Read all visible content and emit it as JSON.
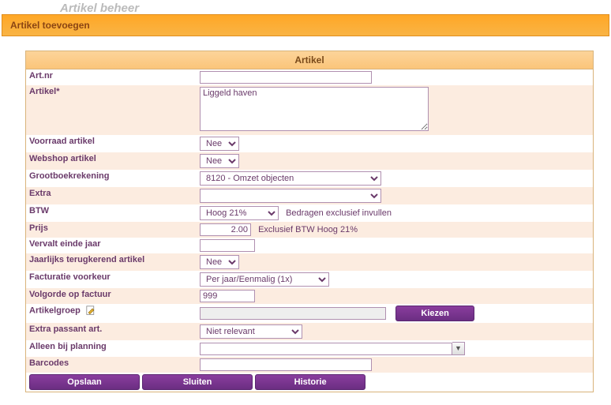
{
  "ghost_header": "Artikel beheer",
  "dialog_title": "Artikel toevoegen",
  "panel_title": "Artikel",
  "labels": {
    "artnr": "Art.nr",
    "artikel": "Artikel*",
    "voorraad": "Voorraad artikel",
    "webshop": "Webshop artikel",
    "grootboek": "Grootboekrekening",
    "extra": "Extra",
    "btw": "BTW",
    "prijs": "Prijs",
    "vervalt": "Vervalt einde jaar",
    "jaarlijks": "Jaarlijks terugkerend artikel",
    "factvoorkeur": "Facturatie voorkeur",
    "volgorde": "Volgorde op factuur",
    "artikelgroep": "Artikelgroep",
    "extrapassant": "Extra passant art.",
    "alleenplanning": "Alleen bij planning",
    "barcodes": "Barcodes"
  },
  "values": {
    "artnr": "",
    "artikel": "Liggeld haven",
    "voorraad": "Nee",
    "webshop": "Nee",
    "grootboek": "8120 - Omzet objecten",
    "extra": "",
    "btw": "Hoog 21%",
    "prijs": "2.00",
    "vervalt": "",
    "jaarlijks": "Nee",
    "factvoorkeur": "Per jaar/Eenmalig (1x)",
    "volgorde": "999",
    "artikelgroep": "",
    "extrapassant": "Niet relevant",
    "alleenplanning": "",
    "barcodes": ""
  },
  "hints": {
    "btw_note": "Bedragen exclusief invullen",
    "prijs_note": "Exclusief BTW Hoog 21%"
  },
  "buttons": {
    "kiezen": "Kiezen",
    "opslaan": "Opslaan",
    "sluiten": "Sluiten",
    "historie": "Historie"
  }
}
